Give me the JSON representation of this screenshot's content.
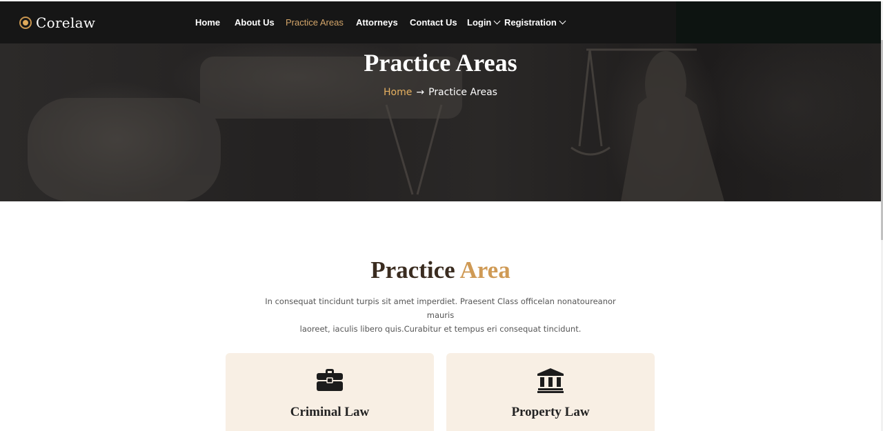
{
  "brand": {
    "name": "Corelaw"
  },
  "nav": {
    "items": [
      {
        "label": "Home",
        "active": false
      },
      {
        "label": "About Us",
        "active": false
      },
      {
        "label": "Practice Areas",
        "active": true
      },
      {
        "label": "Attorneys",
        "active": false
      },
      {
        "label": "Contact Us",
        "active": false
      },
      {
        "label": "Login",
        "active": false,
        "dropdown": true
      },
      {
        "label": "Registration",
        "active": false,
        "dropdown": true
      }
    ]
  },
  "hero": {
    "title": "Practice Areas",
    "breadcrumb": {
      "home": "Home",
      "separator": "→",
      "current": "Practice Areas"
    }
  },
  "section": {
    "title_part1": "Practice",
    "title_part2": "Area",
    "description_line1": "In consequat tincidunt turpis sit amet imperdiet. Praesent Class officelan nonatoureanor mauris",
    "description_line2": "laoreet, iaculis libero quis.Curabitur et tempus eri consequat tincidunt."
  },
  "cards": [
    {
      "title": "Criminal Law",
      "icon": "briefcase-icon"
    },
    {
      "title": "Property Law",
      "icon": "bank-icon"
    }
  ],
  "colors": {
    "accent": "#cf9a55",
    "nav_active": "#d4a66a",
    "navbar_bg": "#161616",
    "card_bg": "#f8efe4",
    "title_dark": "#3a2c20"
  }
}
